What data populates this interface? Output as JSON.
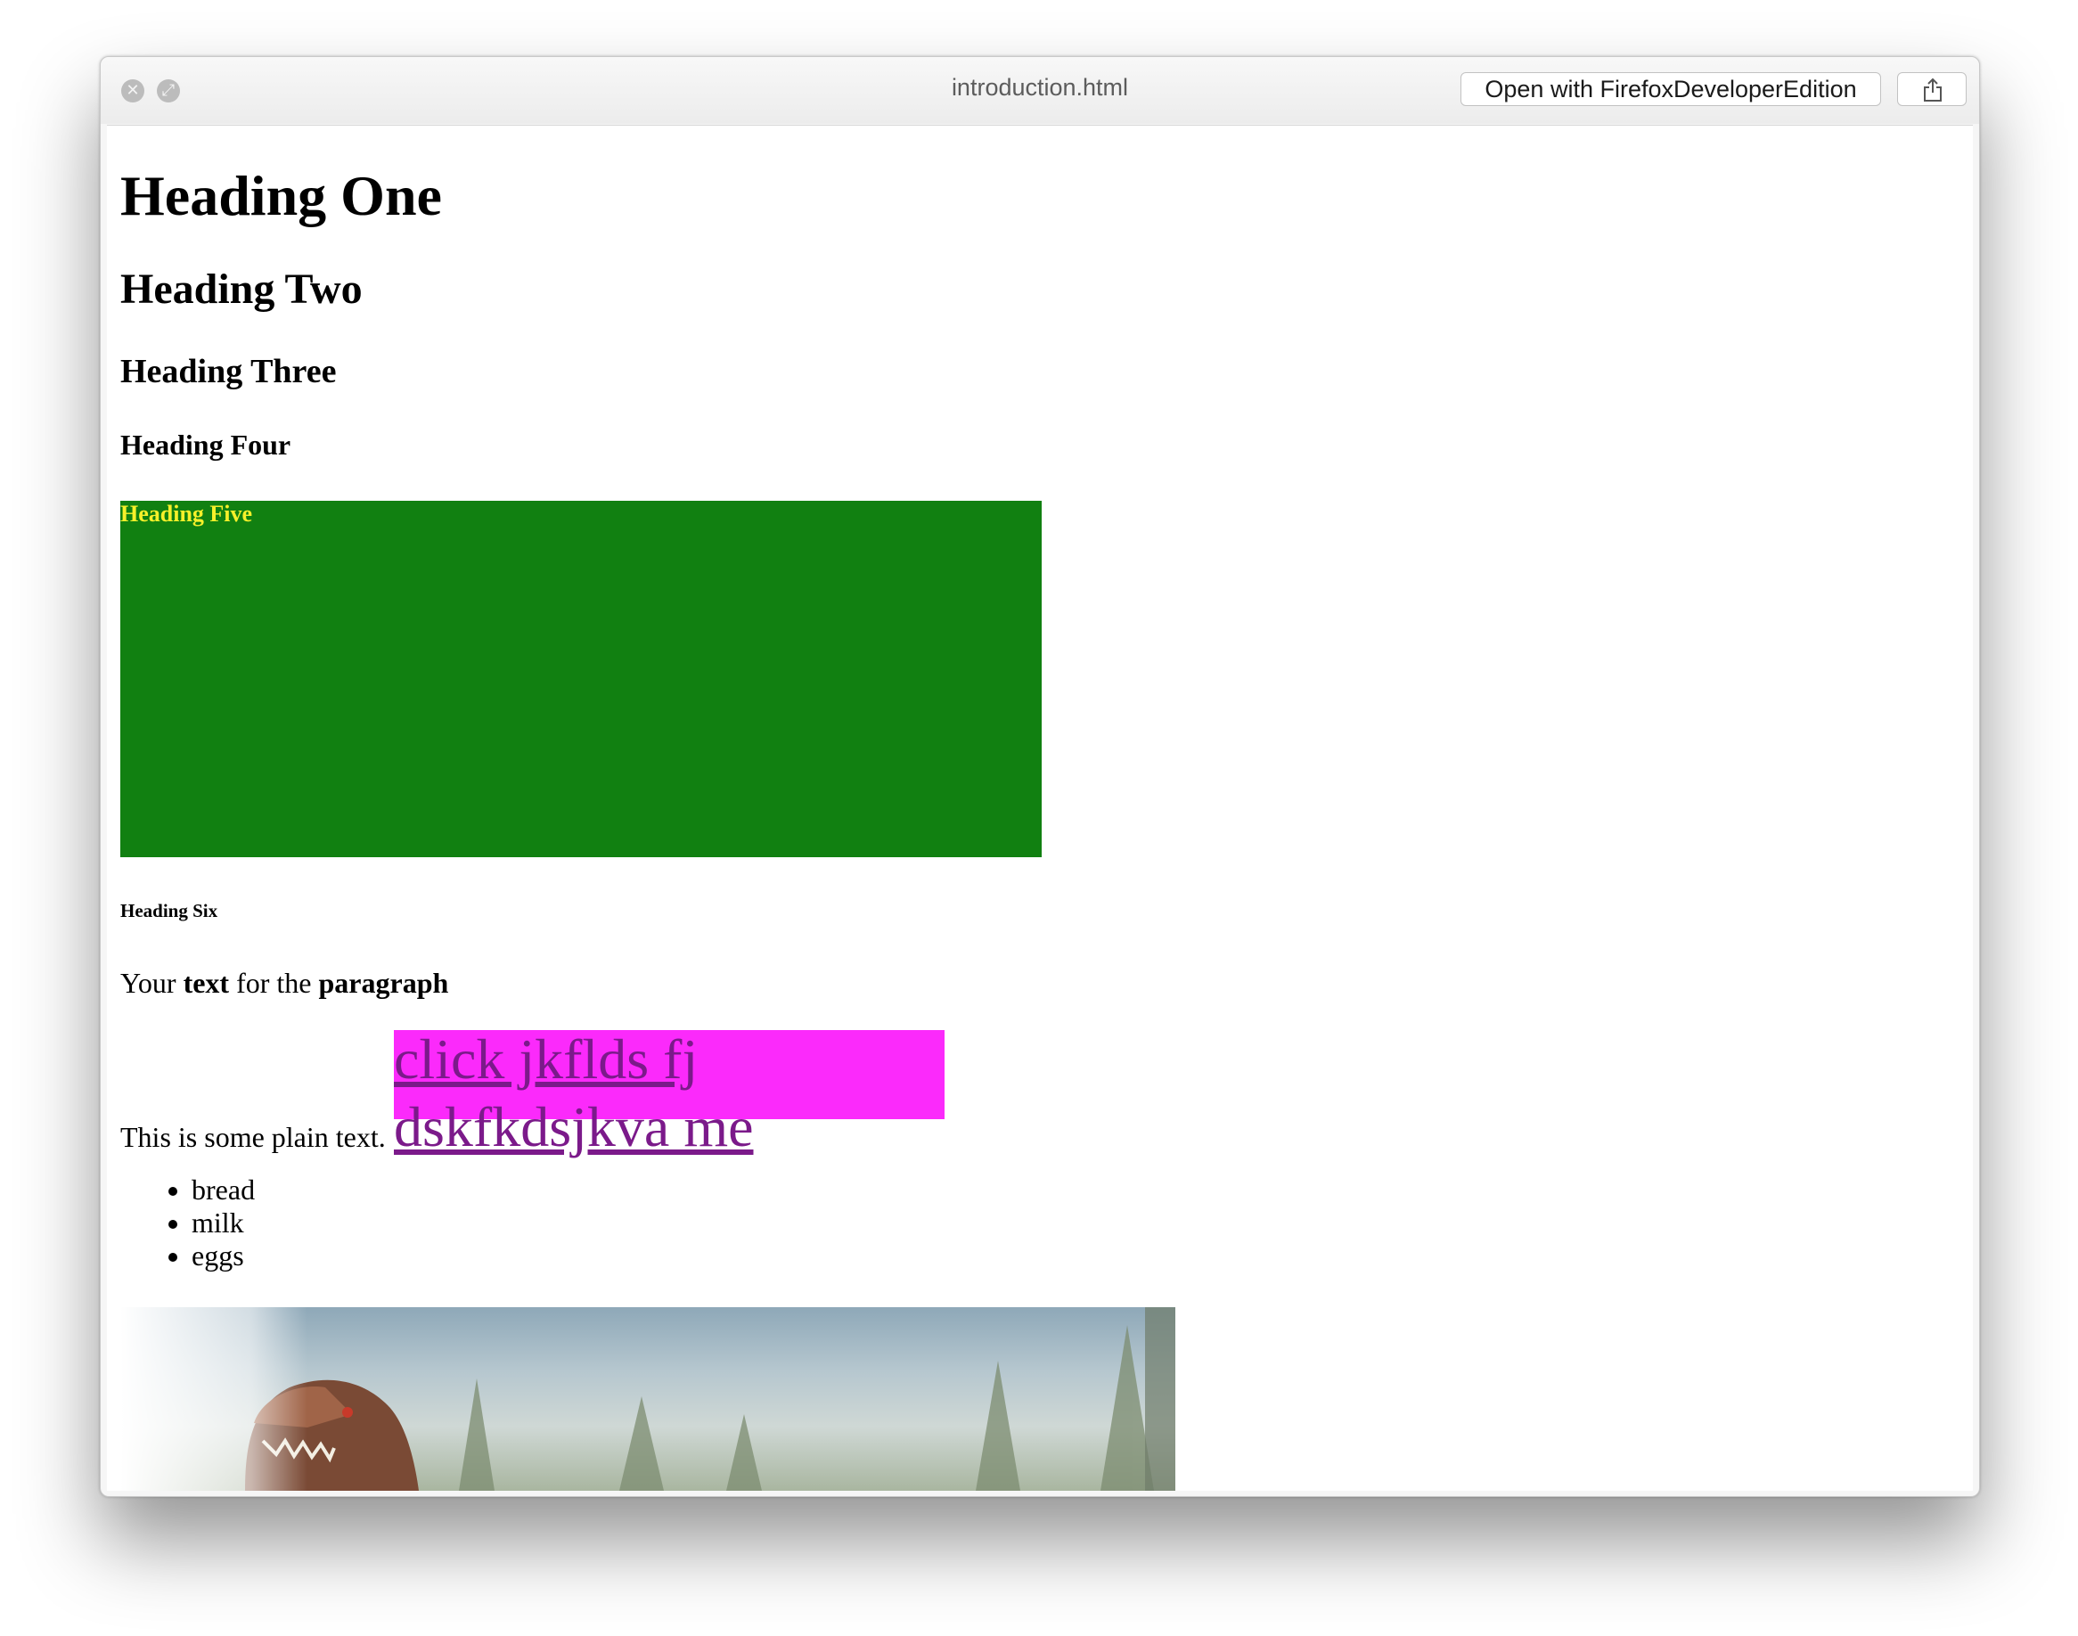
{
  "window": {
    "title": "introduction.html",
    "open_with_label": "Open with FirefoxDeveloperEdition",
    "share_icon": "share-icon",
    "close_icon": "close-icon",
    "fullscreen_icon": "fullscreen-icon"
  },
  "page": {
    "h1": "Heading One",
    "h2": "Heading Two",
    "h3": "Heading Three",
    "h4": "Heading Four",
    "h5": "Heading Five",
    "h6": "Heading Six",
    "paragraph": {
      "part1": "Your ",
      "bold1": "text",
      "part2": " for the ",
      "bold2": "paragraph"
    },
    "plain_text": "This is some plain text.",
    "link_text": "click jkflds fj dskfkdsjkva me",
    "list": [
      "bread",
      "milk",
      "eggs"
    ],
    "colors": {
      "h5_background": "#118011",
      "h5_text": "#f6f02a",
      "link_background": "#fb2afb",
      "link_text": "#7b1a8a"
    },
    "image": "dinosaur-image"
  }
}
